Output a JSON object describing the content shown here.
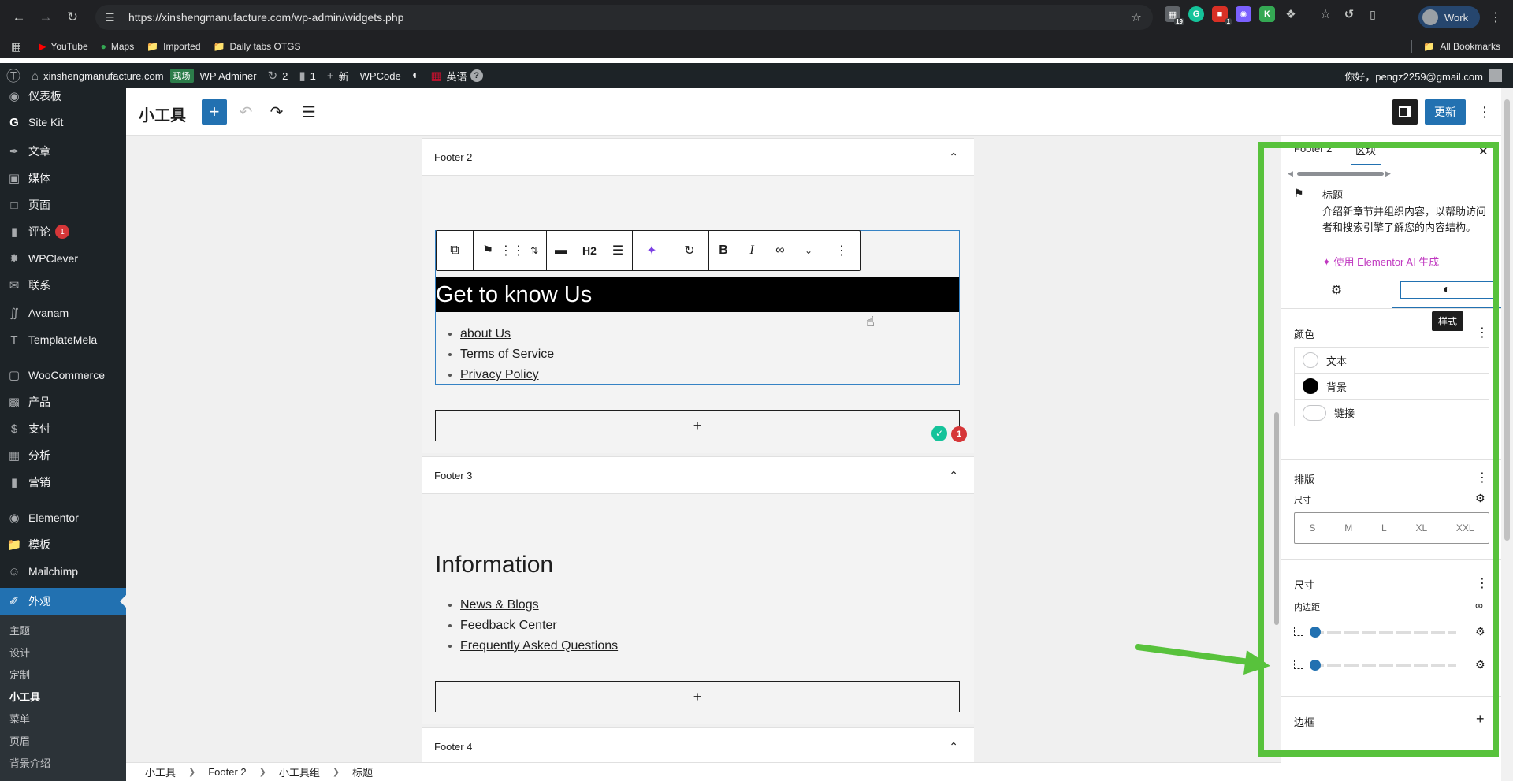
{
  "browser": {
    "url": "https://xinshengmanufacture.com/wp-admin/widgets.php",
    "profile_label": "Work",
    "bookmarks": [
      "YouTube",
      "Maps",
      "Imported",
      "Daily tabs OTGS"
    ],
    "all_bookmarks": "All Bookmarks",
    "extensions": [
      {
        "name": "ext-badge-19",
        "badge": "19",
        "color": "#5f6368"
      },
      {
        "name": "grammarly",
        "badge": "",
        "color": "#15c39a"
      },
      {
        "name": "ext-red",
        "badge": "1",
        "color": "#d93025"
      },
      {
        "name": "ext-purple",
        "badge": "",
        "color": "#7b61ff"
      },
      {
        "name": "ext-k",
        "badge": "",
        "color": "#34a853"
      }
    ]
  },
  "adminbar": {
    "site": "xinshengmanufacture.com",
    "env_tag": "现场",
    "wp_adminer": "WP Adminer",
    "updates": "2",
    "comments": "1",
    "new": "新",
    "wpcode": "WPCode",
    "language": "英语",
    "greeting": "你好，pengz2259@gmail.com"
  },
  "sidebar": {
    "items": [
      {
        "label": "仪表板",
        "icon": "dashboard-icon"
      },
      {
        "label": "Site Kit",
        "icon": "sitekit-icon"
      },
      {
        "label": "文章",
        "icon": "posts-icon"
      },
      {
        "label": "媒体",
        "icon": "media-icon"
      },
      {
        "label": "页面",
        "icon": "pages-icon"
      },
      {
        "label": "评论",
        "icon": "comments-icon",
        "badge": "1"
      },
      {
        "label": "WPClever",
        "icon": "wpclever-icon"
      },
      {
        "label": "联系",
        "icon": "contact-icon"
      },
      {
        "label": "Avanam",
        "icon": "avanam-icon"
      },
      {
        "label": "TemplateMela",
        "icon": "templatemela-icon"
      },
      {
        "label": "WooCommerce",
        "icon": "woocommerce-icon"
      },
      {
        "label": "产品",
        "icon": "products-icon"
      },
      {
        "label": "支付",
        "icon": "payments-icon"
      },
      {
        "label": "分析",
        "icon": "analytics-icon"
      },
      {
        "label": "营销",
        "icon": "marketing-icon"
      },
      {
        "label": "Elementor",
        "icon": "elementor-icon"
      },
      {
        "label": "模板",
        "icon": "templates-icon"
      },
      {
        "label": "Mailchimp",
        "icon": "mailchimp-icon"
      },
      {
        "label": "外观",
        "icon": "appearance-icon"
      }
    ],
    "submenu": [
      "主题",
      "设计",
      "定制",
      "小工具",
      "菜单",
      "页眉",
      "背景介绍"
    ]
  },
  "editor": {
    "title": "小工具",
    "update_button": "更新",
    "toolbar": {
      "heading_level": "H2"
    }
  },
  "canvas": {
    "areas": [
      {
        "title": "Footer 2"
      },
      {
        "title": "Footer 3"
      },
      {
        "title": "Footer 4"
      }
    ],
    "footer2": {
      "heading": "Get to know Us",
      "links": [
        "about Us",
        "Terms of Service",
        "Privacy Policy"
      ]
    },
    "footer3": {
      "heading": "Information",
      "links": [
        "News & Blogs",
        "Feedback Center",
        "Frequently Asked Questions"
      ]
    },
    "appender_label": "+",
    "grammarly_count": "1"
  },
  "breadcrumbs": [
    "小工具",
    "Footer 2",
    "小工具组",
    "标题"
  ],
  "inspector": {
    "tabs": [
      "Footer 2",
      "区块"
    ],
    "block": {
      "title": "标题",
      "description": "介绍新章节并组织内容，以帮助访问者和搜索引擎了解您的内容结构。",
      "ai_link": "使用 Elementor AI 生成"
    },
    "style_tooltip": "样式",
    "color": {
      "title": "颜色",
      "items": [
        "文本",
        "背景",
        "链接"
      ]
    },
    "typography": {
      "title": "排版",
      "size_label": "尺寸",
      "sizes": [
        "S",
        "M",
        "L",
        "XL",
        "XXL"
      ]
    },
    "dimensions": {
      "title": "尺寸",
      "padding_label": "内边距",
      "padding_vertical": 0,
      "padding_horizontal": 0
    },
    "border": {
      "title": "边框"
    }
  },
  "colors": {
    "wp_blue": "#2271b1",
    "admin_dark": "#1d2327",
    "annotation_green": "#58c23c"
  }
}
